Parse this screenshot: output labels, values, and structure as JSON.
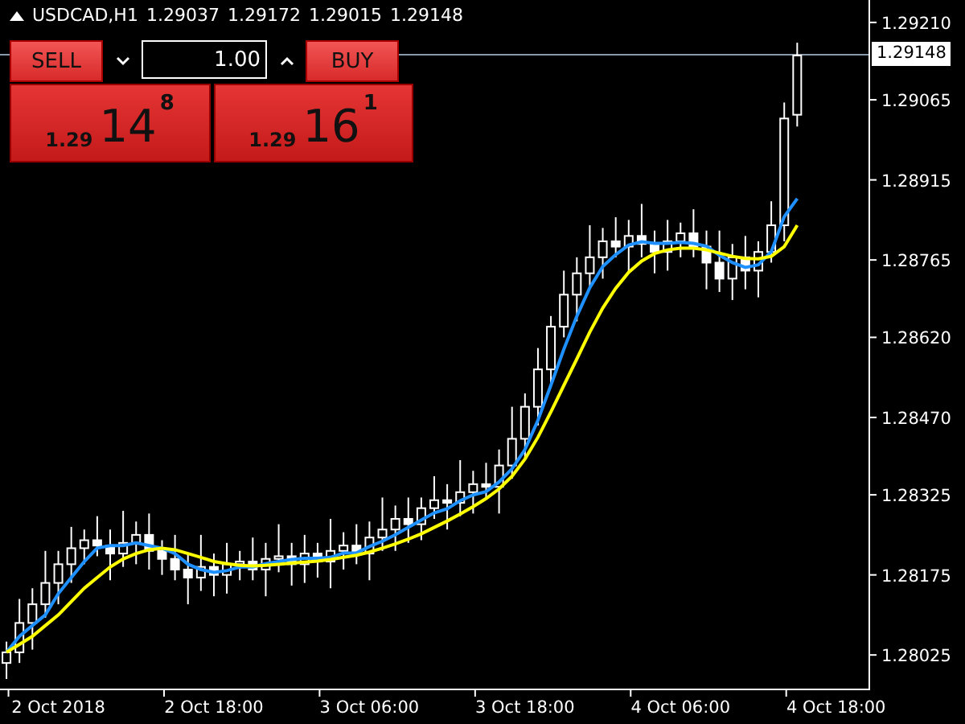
{
  "symbol_header": {
    "symbol": "USDCAD,H1",
    "open": "1.29037",
    "high": "1.29172",
    "low": "1.29015",
    "close": "1.29148"
  },
  "trade_panel": {
    "sell_label": "SELL",
    "buy_label": "BUY",
    "lot_value": "1.00",
    "bid": {
      "prefix": "1.29",
      "big": "14",
      "pip": "8"
    },
    "ask": {
      "prefix": "1.29",
      "big": "16",
      "pip": "1"
    }
  },
  "chart_data": {
    "type": "candlestick",
    "categories": [
      null,
      null,
      null,
      null,
      "2 Oct 2018",
      null,
      null,
      null,
      null,
      null,
      null,
      null,
      null,
      null,
      null,
      null,
      "2 Oct 18:00",
      null,
      null,
      null,
      null,
      null,
      null,
      null,
      null,
      null,
      null,
      null,
      "3 Oct 06:00",
      null,
      null,
      null,
      null,
      null,
      null,
      null,
      null,
      null,
      null,
      null,
      "3 Oct 18:00",
      null,
      null,
      null,
      null,
      null,
      null,
      null,
      null,
      null,
      null,
      null,
      "4 Oct 06:00",
      null,
      null,
      null,
      null,
      null,
      null,
      null,
      null,
      null,
      null,
      null,
      "4 Oct 18:00",
      null,
      null
    ],
    "ylim": [
      1.27962,
      1.29252
    ],
    "yticks": [
      {
        "value": 1.2921,
        "label": "1.29210"
      },
      {
        "value": 1.29065,
        "label": "1.29065"
      },
      {
        "value": 1.28915,
        "label": "1.28915"
      },
      {
        "value": 1.28765,
        "label": "1.28765"
      },
      {
        "value": 1.2862,
        "label": "1.28620"
      },
      {
        "value": 1.2847,
        "label": "1.28470"
      },
      {
        "value": 1.28325,
        "label": "1.28325"
      },
      {
        "value": 1.28175,
        "label": "1.28175"
      },
      {
        "value": 1.28025,
        "label": "1.28025"
      }
    ],
    "ohlc": [
      [
        1.2801,
        1.2805,
        1.2798,
        1.2803
      ],
      [
        1.2803,
        1.2813,
        1.2801,
        1.28085
      ],
      [
        1.28085,
        1.2815,
        1.28035,
        1.2812
      ],
      [
        1.2812,
        1.2822,
        1.28095,
        1.2816
      ],
      [
        1.2816,
        1.2822,
        1.2812,
        1.28195
      ],
      [
        1.28195,
        1.28265,
        1.2816,
        1.28225
      ],
      [
        1.28225,
        1.2826,
        1.28195,
        1.2824
      ],
      [
        1.2824,
        1.28285,
        1.2821,
        1.2823
      ],
      [
        1.2823,
        1.2826,
        1.28165,
        1.28215
      ],
      [
        1.28215,
        1.28295,
        1.2819,
        1.28235
      ],
      [
        1.28235,
        1.28275,
        1.28195,
        1.2825
      ],
      [
        1.2825,
        1.2829,
        1.28185,
        1.2822
      ],
      [
        1.2822,
        1.2824,
        1.28175,
        1.28205
      ],
      [
        1.28205,
        1.2825,
        1.28165,
        1.28185
      ],
      [
        1.28185,
        1.28215,
        1.2812,
        1.2817
      ],
      [
        1.2817,
        1.2825,
        1.28145,
        1.2819
      ],
      [
        1.2819,
        1.28215,
        1.28135,
        1.28175
      ],
      [
        1.28175,
        1.28235,
        1.2814,
        1.28195
      ],
      [
        1.28195,
        1.2822,
        1.28165,
        1.282
      ],
      [
        1.282,
        1.28245,
        1.28165,
        1.28185
      ],
      [
        1.28185,
        1.28235,
        1.28135,
        1.28205
      ],
      [
        1.28205,
        1.2827,
        1.2818,
        1.2821
      ],
      [
        1.2821,
        1.28235,
        1.28155,
        1.28195
      ],
      [
        1.28195,
        1.2825,
        1.2816,
        1.28215
      ],
      [
        1.28215,
        1.28235,
        1.2817,
        1.282
      ],
      [
        1.282,
        1.2828,
        1.2815,
        1.2822
      ],
      [
        1.2822,
        1.28255,
        1.28185,
        1.2823
      ],
      [
        1.2823,
        1.2827,
        1.28195,
        1.28215
      ],
      [
        1.28215,
        1.28275,
        1.28165,
        1.28245
      ],
      [
        1.28245,
        1.2832,
        1.2822,
        1.2826
      ],
      [
        1.2826,
        1.28305,
        1.2822,
        1.2828
      ],
      [
        1.2828,
        1.2832,
        1.28235,
        1.2827
      ],
      [
        1.2827,
        1.2832,
        1.2824,
        1.283
      ],
      [
        1.283,
        1.2836,
        1.2828,
        1.28315
      ],
      [
        1.28315,
        1.28345,
        1.2826,
        1.2831
      ],
      [
        1.2831,
        1.2839,
        1.28285,
        1.2833
      ],
      [
        1.2833,
        1.2837,
        1.2829,
        1.28345
      ],
      [
        1.28345,
        1.28385,
        1.2832,
        1.2834
      ],
      [
        1.2834,
        1.2841,
        1.2829,
        1.2838
      ],
      [
        1.2838,
        1.2849,
        1.28355,
        1.2843
      ],
      [
        1.2843,
        1.28515,
        1.2839,
        1.2849
      ],
      [
        1.2849,
        1.286,
        1.28455,
        1.2856
      ],
      [
        1.2856,
        1.2866,
        1.2853,
        1.2864
      ],
      [
        1.2864,
        1.28745,
        1.2862,
        1.287
      ],
      [
        1.287,
        1.2877,
        1.2865,
        1.2874
      ],
      [
        1.2874,
        1.2883,
        1.28715,
        1.2877
      ],
      [
        1.2877,
        1.28825,
        1.2873,
        1.288
      ],
      [
        1.288,
        1.28845,
        1.2877,
        1.2879
      ],
      [
        1.2879,
        1.2884,
        1.2874,
        1.2881
      ],
      [
        1.2881,
        1.2887,
        1.2877,
        1.28795
      ],
      [
        1.28795,
        1.2882,
        1.2874,
        1.2878
      ],
      [
        1.2878,
        1.2884,
        1.28745,
        1.288
      ],
      [
        1.288,
        1.28835,
        1.2877,
        1.28815
      ],
      [
        1.28815,
        1.2886,
        1.2877,
        1.2879
      ],
      [
        1.2879,
        1.2882,
        1.2871,
        1.2876
      ],
      [
        1.2876,
        1.2882,
        1.28705,
        1.2873
      ],
      [
        1.2873,
        1.28795,
        1.2869,
        1.2877
      ],
      [
        1.2877,
        1.2881,
        1.2871,
        1.28745
      ],
      [
        1.28745,
        1.288,
        1.28695,
        1.2878
      ],
      [
        1.2878,
        1.28875,
        1.2876,
        1.2883
      ],
      [
        1.2883,
        1.2906,
        1.288,
        1.2903
      ],
      [
        1.29037,
        1.29172,
        1.29015,
        1.29148
      ],
      null,
      null,
      null,
      null,
      null
    ],
    "series": [
      {
        "type": "line",
        "color": "#1e90ff",
        "values": [
          1.2803,
          1.2806,
          1.2808,
          1.281,
          1.2814,
          1.2817,
          1.282,
          1.28225,
          1.2823,
          1.2823,
          1.28235,
          1.2823,
          1.28225,
          1.28215,
          1.28195,
          1.28185,
          1.2818,
          1.28183,
          1.2819,
          1.2819,
          1.28196,
          1.282,
          1.28204,
          1.28206,
          1.28206,
          1.28208,
          1.28216,
          1.28216,
          1.28228,
          1.28238,
          1.2825,
          1.28264,
          1.28278,
          1.28291,
          1.28299,
          1.28314,
          1.28325,
          1.28331,
          1.28349,
          1.28374,
          1.2841,
          1.28465,
          1.2853,
          1.28598,
          1.2866,
          1.28713,
          1.28753,
          1.28775,
          1.28793,
          1.28799,
          1.28796,
          1.28796,
          1.28798,
          1.28796,
          1.28791,
          1.28774,
          1.2876,
          1.28751,
          1.28756,
          1.28781,
          1.28846,
          1.2888,
          null,
          null,
          null,
          null,
          null
        ]
      },
      {
        "type": "line",
        "color": "#ffff00",
        "values": [
          1.2803,
          1.28045,
          1.2806,
          1.2808,
          1.281,
          1.28125,
          1.2815,
          1.2817,
          1.2819,
          1.28205,
          1.28215,
          1.28222,
          1.28225,
          1.28222,
          1.28215,
          1.28208,
          1.282,
          1.28196,
          1.28193,
          1.28192,
          1.28193,
          1.28195,
          1.28197,
          1.28199,
          1.28201,
          1.28204,
          1.28208,
          1.28212,
          1.28218,
          1.28225,
          1.28233,
          1.28242,
          1.28252,
          1.28264,
          1.28276,
          1.28289,
          1.28303,
          1.28318,
          1.28336,
          1.2836,
          1.28392,
          1.28433,
          1.2848,
          1.2853,
          1.2858,
          1.2863,
          1.28675,
          1.28712,
          1.28742,
          1.28763,
          1.28777,
          1.28784,
          1.28787,
          1.28787,
          1.28784,
          1.28778,
          1.28772,
          1.28768,
          1.28767,
          1.28772,
          1.2879,
          1.2883,
          null,
          null,
          null,
          null,
          null
        ]
      }
    ]
  },
  "current_price": "1.29148"
}
